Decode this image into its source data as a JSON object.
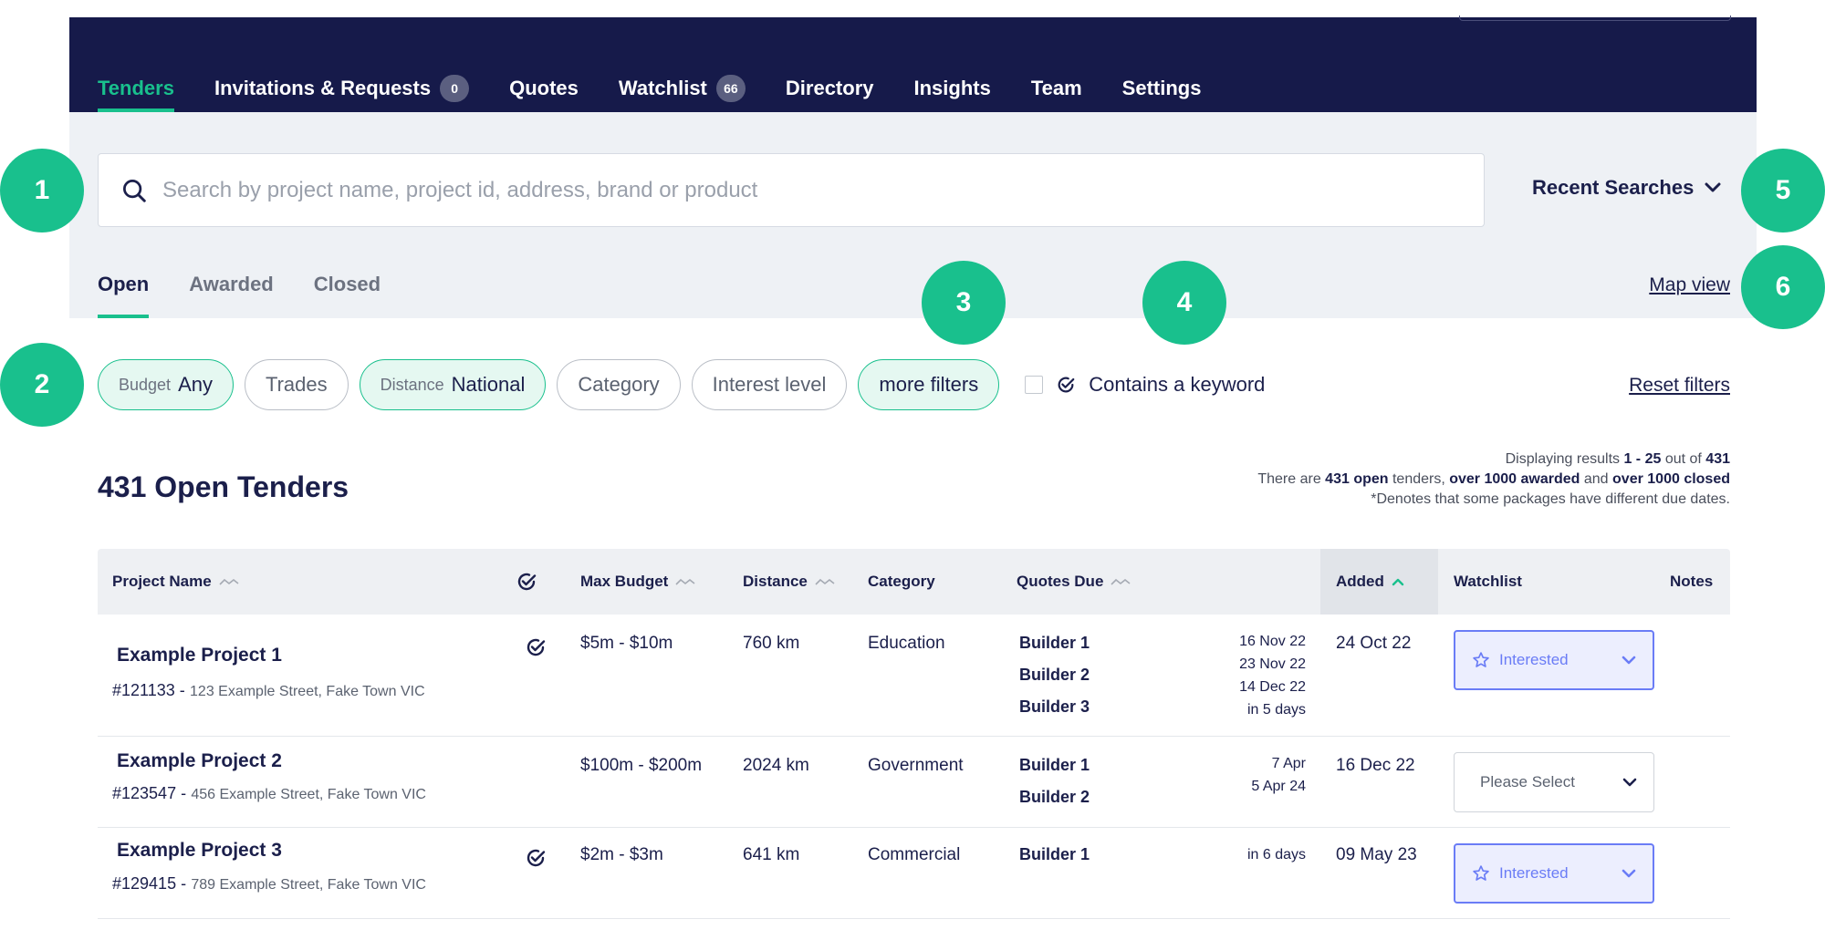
{
  "nav": {
    "tabs": [
      {
        "label": "Tenders",
        "badge": null,
        "active": true
      },
      {
        "label": "Invitations & Requests",
        "badge": "0"
      },
      {
        "label": "Quotes",
        "badge": null
      },
      {
        "label": "Watchlist",
        "badge": "66"
      },
      {
        "label": "Directory",
        "badge": null
      },
      {
        "label": "Insights",
        "badge": null
      },
      {
        "label": "Team",
        "badge": null
      },
      {
        "label": "Settings",
        "badge": null
      }
    ]
  },
  "search": {
    "placeholder": "Search by project name, project id, address, brand or product",
    "value": "",
    "recent_label": "Recent Searches"
  },
  "status_tabs": [
    {
      "label": "Open",
      "active": true
    },
    {
      "label": "Awarded"
    },
    {
      "label": "Closed"
    }
  ],
  "map_view_label": "Map view",
  "filters": {
    "budget": {
      "label": "Budget",
      "value": "Any"
    },
    "trades": "Trades",
    "distance": {
      "label": "Distance",
      "value": "National"
    },
    "category": "Category",
    "interest": "Interest level",
    "more": "more filters",
    "keyword": "Contains a keyword",
    "reset": "Reset filters"
  },
  "page_title": "431 Open Tenders",
  "summary": {
    "line1_pre": "Displaying results ",
    "line1_range": "1 - 25",
    "line1_mid": " out of ",
    "line1_total": "431",
    "line2_pre": "There are ",
    "line2_open": "431 open",
    "line2_mid1": " tenders, ",
    "line2_awarded": "over 1000 awarded",
    "line2_mid2": " and ",
    "line2_closed": "over 1000 closed",
    "line3": "*Denotes that some packages have different due dates."
  },
  "table": {
    "headers": {
      "project": "Project Name",
      "budget": "Max Budget",
      "distance": "Distance",
      "category": "Category",
      "quotes_due": "Quotes Due",
      "added": "Added",
      "watchlist": "Watchlist",
      "notes": "Notes"
    },
    "rows": [
      {
        "name": "Example Project 1",
        "id": "#121133 -",
        "address": "123 Example Street, Fake Town VIC",
        "verified": true,
        "budget": "$5m - $10m",
        "distance": "760 km",
        "category": "Education",
        "builders": [
          "Builder 1",
          "Builder 2",
          "Builder 3"
        ],
        "dates": [
          "16 Nov 22",
          "23 Nov 22",
          "14 Dec 22",
          "in 5 days"
        ],
        "added": "24 Oct 22",
        "watch": "Interested"
      },
      {
        "name": "Example Project 2",
        "id": "#123547 -",
        "address": "456 Example Street, Fake Town VIC",
        "verified": false,
        "budget": "$100m - $200m",
        "distance": "2024 km",
        "category": "Government",
        "builders": [
          "Builder 1",
          "Builder 2"
        ],
        "dates": [
          "7 Apr",
          "5 Apr 24"
        ],
        "added": "16 Dec 22",
        "watch": "Please Select"
      },
      {
        "name": "Example Project 3",
        "id": "#129415 -",
        "address": "789 Example Street, Fake Town VIC",
        "verified": true,
        "budget": "$2m - $3m",
        "distance": "641 km",
        "category": "Commercial",
        "builders": [
          "Builder 1"
        ],
        "dates": [
          "in 6 days"
        ],
        "added": "09 May 23",
        "watch": "Interested"
      }
    ]
  },
  "callouts": [
    "1",
    "2",
    "3",
    "4",
    "5",
    "6"
  ],
  "colors": {
    "nav_bg": "#161a4a",
    "accent": "#19c08d",
    "panel_bg": "#eef1f5",
    "interested": "#6a7cf6"
  },
  "icons": {
    "search": "search-icon",
    "chevron": "chevron-down-icon",
    "verified": "check-badge-icon",
    "star": "star-icon",
    "sort": "sort-icon"
  }
}
